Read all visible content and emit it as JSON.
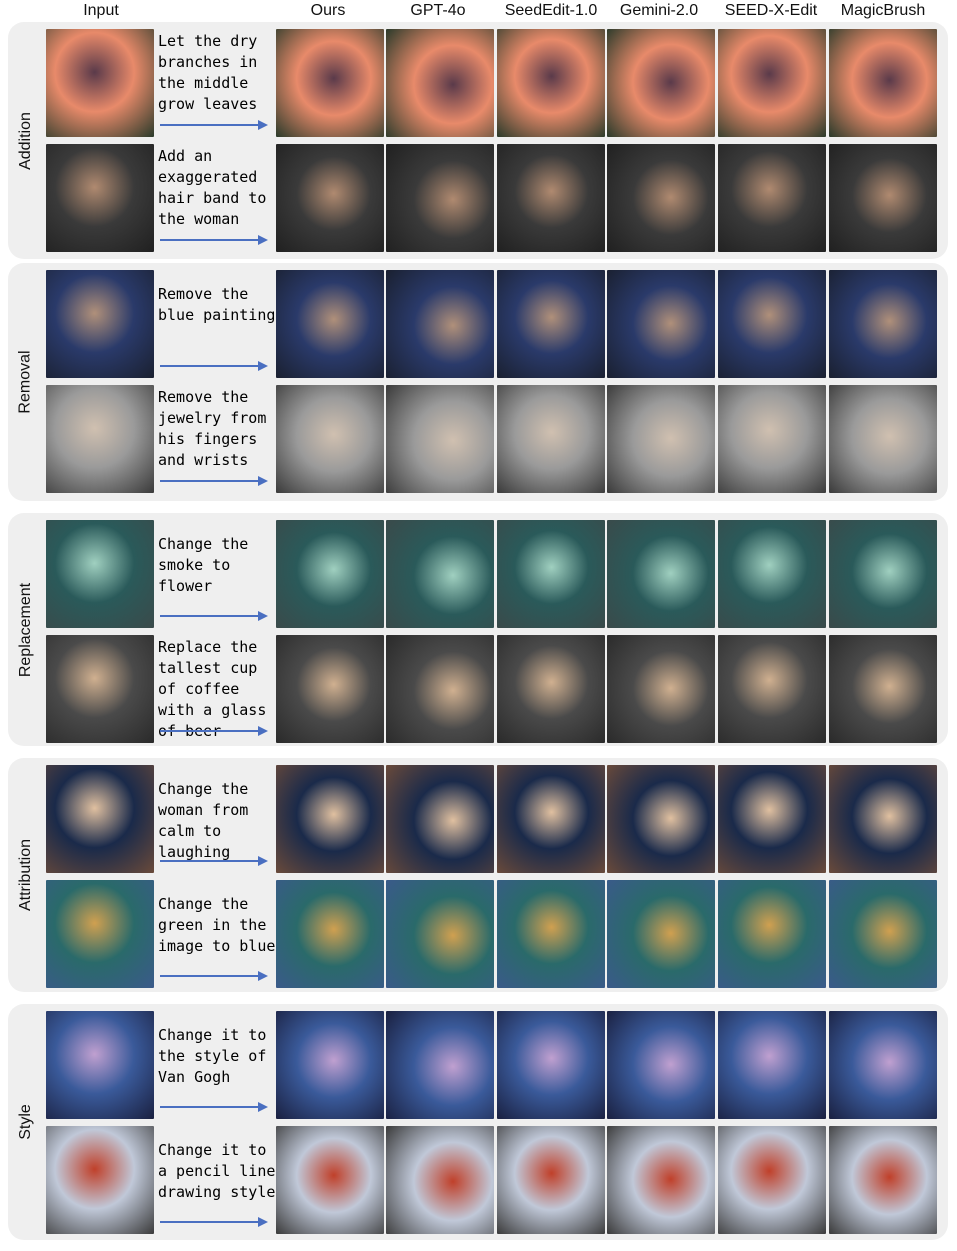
{
  "columns": [
    "Input",
    "Ours",
    "GPT-4o",
    "SeedEdit-1.0",
    "Gemini-2.0",
    "SEED-X-Edit",
    "MagicBrush"
  ],
  "groups": [
    {
      "label": "Addition",
      "rows": [
        {
          "instruction": "Let the dry branches in the middle grow leaves",
          "icon": "sunset-lake-tree-icon"
        },
        {
          "instruction": "Add an exaggerated hair band to the woman",
          "icon": "woman-portrait-icon"
        }
      ]
    },
    {
      "label": "Removal",
      "rows": [
        {
          "instruction": "Remove the blue painting",
          "icon": "living-room-icon"
        },
        {
          "instruction": "Remove the jewelry from his fingers and wrists",
          "icon": "man-portrait-icon"
        }
      ]
    },
    {
      "label": "Replacement",
      "rows": [
        {
          "instruction": "Change the smoke to flower",
          "icon": "teacup-smoke-icon"
        },
        {
          "instruction": "Replace the tallest cup of coffee with a glass of beer",
          "icon": "coffee-cups-icon"
        }
      ]
    },
    {
      "label": "Attribution",
      "rows": [
        {
          "instruction": "Change the woman from calm to laughing",
          "icon": "painted-woman-icon"
        },
        {
          "instruction": "Change the green in the image to blue",
          "icon": "swirl-painting-icon"
        }
      ]
    },
    {
      "label": "Style",
      "rows": [
        {
          "instruction": "Change it to the style of Van Gogh",
          "icon": "city-night-icon"
        },
        {
          "instruction": "Change it to a pencil line drawing style",
          "icon": "golden-gate-bridge-icon"
        }
      ]
    }
  ],
  "arrow_color": "#4a6fc1"
}
